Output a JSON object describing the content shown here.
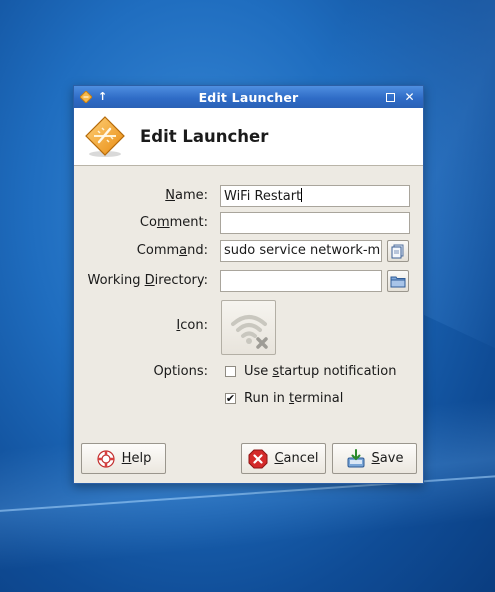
{
  "window": {
    "title": "Edit Launcher",
    "titlebar_icons": {
      "app": "launcher-icon",
      "sticky": "arrow-up-icon",
      "maximize": "maximize-icon",
      "close": "close-icon"
    },
    "close_glyph": "✕",
    "arrow_glyph": "↑"
  },
  "header": {
    "title": "Edit Launcher",
    "icon": "launcher-icon"
  },
  "form": {
    "name": {
      "label_pre": "",
      "label_mnemonic": "N",
      "label_post": "ame:",
      "value": "WiFi Restart"
    },
    "comment": {
      "label_pre": "Co",
      "label_mnemonic": "m",
      "label_post": "ment:",
      "value": ""
    },
    "command": {
      "label_pre": "Comm",
      "label_mnemonic": "a",
      "label_post": "nd:",
      "value": "sudo service network-m"
    },
    "working_directory": {
      "label_pre": "Working ",
      "label_mnemonic": "D",
      "label_post": "irectory:",
      "value": ""
    },
    "icon": {
      "label_pre": "",
      "label_mnemonic": "I",
      "label_post": "con:",
      "icon_name": "wifi-disconnected-icon"
    },
    "options": {
      "label": "Options:",
      "startup_notification": {
        "label_pre": "Use ",
        "label_mnemonic": "s",
        "label_post": "tartup notification",
        "checked": false
      },
      "run_in_terminal": {
        "label_pre": "Run in ",
        "label_mnemonic": "t",
        "label_post": "erminal",
        "checked": true,
        "check_glyph": "✔"
      }
    }
  },
  "buttons": {
    "help": {
      "label_mnemonic": "H",
      "label_post": "elp",
      "icon": "help-lifebuoy-icon"
    },
    "cancel": {
      "label_mnemonic": "C",
      "label_post": "ancel",
      "icon": "cancel-icon"
    },
    "save": {
      "label_mnemonic": "S",
      "label_post": "ave",
      "icon": "save-icon"
    }
  },
  "colors": {
    "titlebar": "#2f6cc7",
    "desktop": "#1f6dbf",
    "dialog_bg": "#edeae3",
    "cancel_red": "#d42a2a",
    "launcher_orange": "#f0a030"
  }
}
